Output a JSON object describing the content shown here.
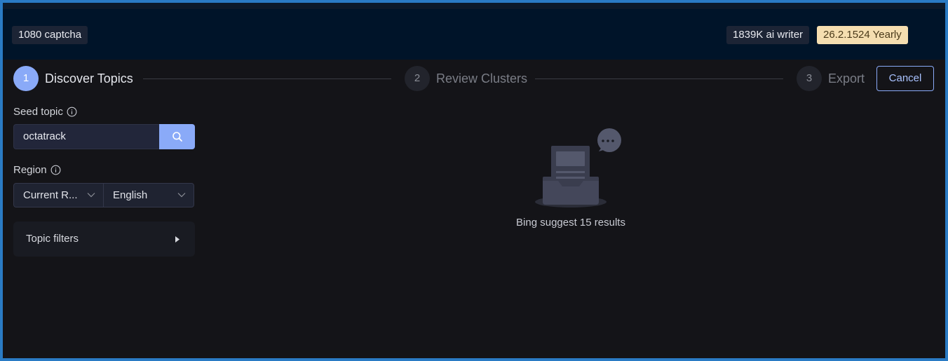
{
  "header": {
    "captcha_chip": "1080 captcha",
    "ai_writer_chip": "1839K ai writer",
    "plan_chip": "26.2.1524 Yearly"
  },
  "steps": [
    {
      "number": "1",
      "label": "Discover Topics",
      "state": "active"
    },
    {
      "number": "2",
      "label": "Review Clusters",
      "state": "inactive"
    },
    {
      "number": "3",
      "label": "Export",
      "state": "inactive"
    }
  ],
  "actions": {
    "cancel_label": "Cancel"
  },
  "form": {
    "seed_topic_label": "Seed topic",
    "seed_topic_value": "octatrack",
    "region_label": "Region",
    "region_value": "Current R...",
    "language_value": "English",
    "topic_filters_label": "Topic filters"
  },
  "results": {
    "message": "Bing suggest 15 results"
  },
  "icons": {
    "info": "info-icon",
    "search": "search-icon",
    "chevron": "chevron-down-icon",
    "expand": "caret-right-icon",
    "empty": "empty-inbox-illustration"
  },
  "colors": {
    "accent": "#8aaaf8",
    "gold_chip": "#f5deb0",
    "header_bg": "#001429",
    "page_bg": "#141418"
  }
}
